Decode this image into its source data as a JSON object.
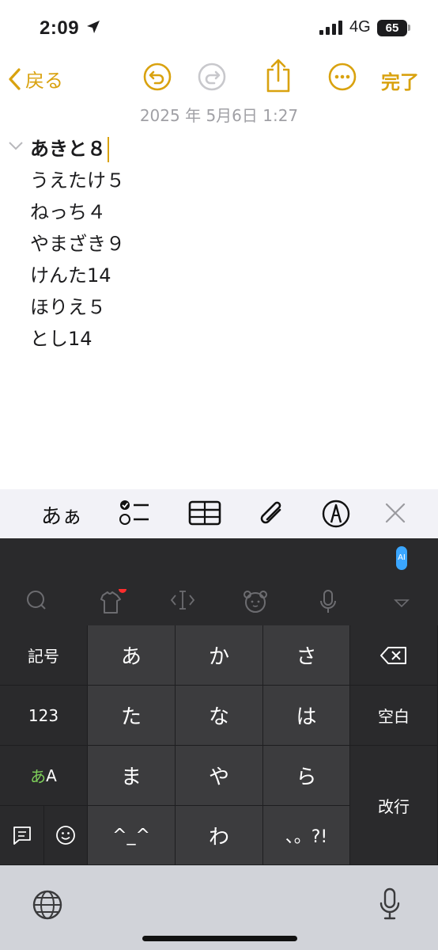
{
  "status": {
    "time": "2:09",
    "network": "4G",
    "battery": "65"
  },
  "nav": {
    "back_label": "戻る",
    "done_label": "完了"
  },
  "note": {
    "date": "2025 年 5月6日 1:27",
    "title": "あきと８",
    "lines": [
      "うえたけ５",
      "ねっち４",
      "やまざき９",
      "けんた14",
      "ほりえ５",
      "とし14"
    ]
  },
  "toolbar": {
    "format_label": "あぁ"
  },
  "keyboard": {
    "rows": [
      [
        "記号",
        "あ",
        "か",
        "さ"
      ],
      [
        "123",
        "た",
        "な",
        "は",
        "空白"
      ],
      [
        "あ",
        "A",
        "ま",
        "や",
        "ら",
        "改行"
      ],
      [
        "^_^",
        "わ",
        "、。?!"
      ]
    ],
    "ai_badge": "AI"
  },
  "colors": {
    "accent": "#d9a20f",
    "keyboard_bg": "#2a2a2c",
    "key_bg": "#3c3c3e"
  },
  "icons": [
    "location-arrow-icon",
    "signal-icon",
    "back-chevron-icon",
    "undo-icon",
    "redo-icon",
    "share-icon",
    "more-icon",
    "checklist-icon",
    "table-icon",
    "attachment-icon",
    "markup-icon",
    "close-icon",
    "search-icon",
    "tshirt-icon",
    "cursor-icon",
    "bear-icon",
    "mic-icon",
    "dismiss-keyboard-icon",
    "delete-icon",
    "memo-icon",
    "emoji-icon",
    "globe-icon"
  ]
}
